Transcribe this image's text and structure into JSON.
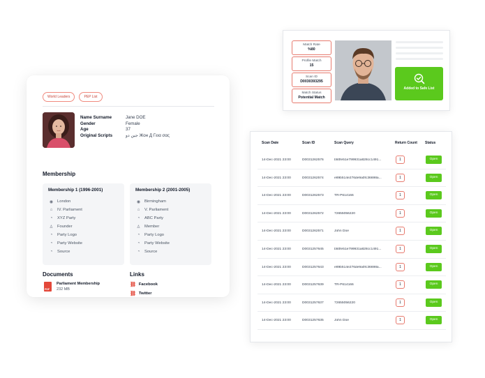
{
  "profile": {
    "tags": [
      "World Leaders",
      "PEP List"
    ],
    "fields": [
      {
        "label": "Name Surname",
        "value": "Jane DOE"
      },
      {
        "label": "Gender",
        "value": "Female"
      },
      {
        "label": "Age",
        "value": "37"
      },
      {
        "label": "Original Scripts",
        "value": "جين دو Жон Д Γεια σας"
      }
    ],
    "membership_title": "Membership",
    "memberships": [
      {
        "title": "Membership 1 (1996-2001)",
        "items": [
          {
            "icon": "location-pin-icon",
            "text": "London"
          },
          {
            "icon": "institution-icon",
            "text": "IV. Parliament"
          },
          {
            "icon": "pie-chart-icon",
            "text": "XYZ Party"
          },
          {
            "icon": "person-icon",
            "text": "Founder"
          },
          {
            "icon": "pie-chart-icon",
            "text": "Party Logo"
          },
          {
            "icon": "pie-chart-icon",
            "text": "Party Website"
          },
          {
            "icon": "pie-chart-icon",
            "text": "Source"
          }
        ]
      },
      {
        "title": "Membership 2 (2001-2005)",
        "items": [
          {
            "icon": "location-pin-icon",
            "text": "Birmingham"
          },
          {
            "icon": "institution-icon",
            "text": "V. Parliament"
          },
          {
            "icon": "pie-chart-icon",
            "text": "ABC Party"
          },
          {
            "icon": "person-icon",
            "text": "Member"
          },
          {
            "icon": "pie-chart-icon",
            "text": "Party Logo"
          },
          {
            "icon": "pie-chart-icon",
            "text": "Party Website"
          },
          {
            "icon": "pie-chart-icon",
            "text": "Source"
          }
        ]
      }
    ],
    "documents_title": "Documents",
    "document": {
      "name": "Parliament Membership",
      "size": "232 MB",
      "badge": "PDF"
    },
    "links_title": "Links",
    "links": [
      "Facebook",
      "Twitter"
    ]
  },
  "match": {
    "boxes": [
      {
        "label": "Match Rate",
        "value": "%80"
      },
      {
        "label": "Profile Match",
        "value": "15"
      },
      {
        "label": "Scan ID",
        "value": "D0030393295"
      },
      {
        "label": "Match Status",
        "value": "Potential Match"
      }
    ],
    "safe_button": "Added to Safe List"
  },
  "scan_table": {
    "headers": [
      "Scan Date",
      "Scan ID",
      "Scan Query",
      "Return Count",
      "Status"
    ],
    "rows": [
      {
        "date": "14-Dec-2021 23:00",
        "id": "D0031262576",
        "query": "b50fe51e799931a828cc1491...",
        "count": "1",
        "status": "Open"
      },
      {
        "date": "14-Dec-2021 23:00",
        "id": "D0031262574",
        "query": "e89b514e276de9a0fc36698a...",
        "count": "1",
        "status": "Open"
      },
      {
        "date": "14-Dec-2021 23:00",
        "id": "D0031262573",
        "query": "TR-P614166",
        "count": "1",
        "status": "Open"
      },
      {
        "date": "14-Dec-2021 23:00",
        "id": "D0031262572",
        "query": "72655056220",
        "count": "1",
        "status": "Open"
      },
      {
        "date": "14-Dec-2021 23:00",
        "id": "D0031262571",
        "query": "John Doe",
        "count": "1",
        "status": "Open"
      },
      {
        "date": "14-Dec-2021 23:00",
        "id": "D0031257645",
        "query": "b50fe51e799931a828cc1491...",
        "count": "1",
        "status": "Open"
      },
      {
        "date": "14-Dec-2021 23:00",
        "id": "D0031257643",
        "query": "e89b514e276de9a0fc36698a...",
        "count": "1",
        "status": "Open"
      },
      {
        "date": "14-Dec-2021 23:00",
        "id": "D0031257639",
        "query": "TR-P614166",
        "count": "1",
        "status": "Open"
      },
      {
        "date": "14-Dec-2021 23:00",
        "id": "D0031257637",
        "query": "72655056220",
        "count": "1",
        "status": "Open"
      },
      {
        "date": "14-Dec-2021 23:00",
        "id": "D0031257635",
        "query": "John Doe",
        "count": "1",
        "status": "Open"
      }
    ]
  },
  "colors": {
    "accent_red": "#e3483a",
    "accent_green": "#5bc91d"
  }
}
